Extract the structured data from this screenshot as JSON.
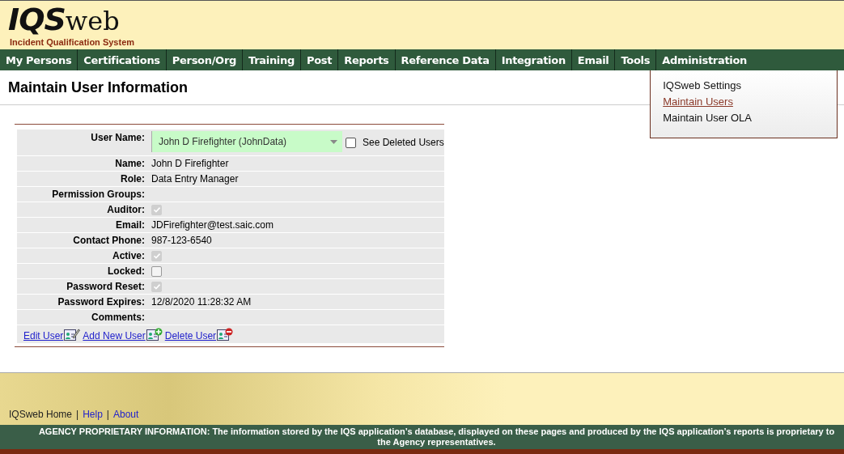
{
  "logo": {
    "mark": "IQS",
    "suffix": "web",
    "tagline": "Incident Qualification System"
  },
  "nav": [
    {
      "label": "My Persons",
      "expanded": false
    },
    {
      "label": "Certifications",
      "expanded": false
    },
    {
      "label": "Person/Org",
      "expanded": false
    },
    {
      "label": "Training",
      "expanded": false
    },
    {
      "label": "Post",
      "expanded": false
    },
    {
      "label": "Reports",
      "expanded": false
    },
    {
      "label": "Reference Data",
      "expanded": false
    },
    {
      "label": "Integration",
      "expanded": false
    },
    {
      "label": "Email",
      "expanded": false
    },
    {
      "label": "Tools",
      "expanded": false
    },
    {
      "label": "Administration",
      "expanded": true,
      "menu": [
        {
          "label": "IQSweb Settings",
          "selected": false
        },
        {
          "label": "Maintain Users",
          "selected": true
        },
        {
          "label": "Maintain User OLA",
          "selected": false
        }
      ]
    }
  ],
  "page_title": "Maintain User Information",
  "form": {
    "rows": [
      {
        "kind": "select",
        "label": "User Name:",
        "value": "John D Firefighter (JohnData)",
        "option": {
          "label": "See Deleted Users",
          "checked": false
        }
      },
      {
        "kind": "text",
        "label": "Name:",
        "value": "John D Firefighter"
      },
      {
        "kind": "text",
        "label": "Role:",
        "value": "Data Entry Manager"
      },
      {
        "kind": "text",
        "label": "Permission Groups:"
      },
      {
        "kind": "checkbox",
        "label": "Auditor:",
        "checked": true
      },
      {
        "kind": "text",
        "label": "Email:",
        "value": "JDFirefighter@test.saic.com"
      },
      {
        "kind": "text",
        "label": "Contact Phone:",
        "value": "987-123-6540"
      },
      {
        "kind": "checkbox",
        "label": "Active:",
        "checked": true
      },
      {
        "kind": "checkbox",
        "label": "Locked:",
        "checked": false
      },
      {
        "kind": "checkbox",
        "label": "Password Reset:",
        "checked": true
      },
      {
        "kind": "text",
        "label": "Password Expires:",
        "value": "12/8/2020 11:28:32 AM"
      },
      {
        "kind": "text",
        "label": "Comments:"
      }
    ],
    "actions": [
      {
        "label": "Edit User",
        "kind": "edit"
      },
      {
        "label": "Add New User",
        "kind": "add"
      },
      {
        "label": "Delete User",
        "kind": "delete"
      }
    ]
  },
  "footer": {
    "links": [
      {
        "label": "IQSweb Home",
        "selected": true
      },
      {
        "label": "Help",
        "selected": false
      },
      {
        "label": "About",
        "selected": false
      }
    ],
    "separator": "|",
    "notice": "AGENCY PROPRIETARY INFORMATION: The information stored by the IQS application’s database, displayed on these pages and produced by the IQS application’s reports is proprietary to the Agency representatives."
  }
}
